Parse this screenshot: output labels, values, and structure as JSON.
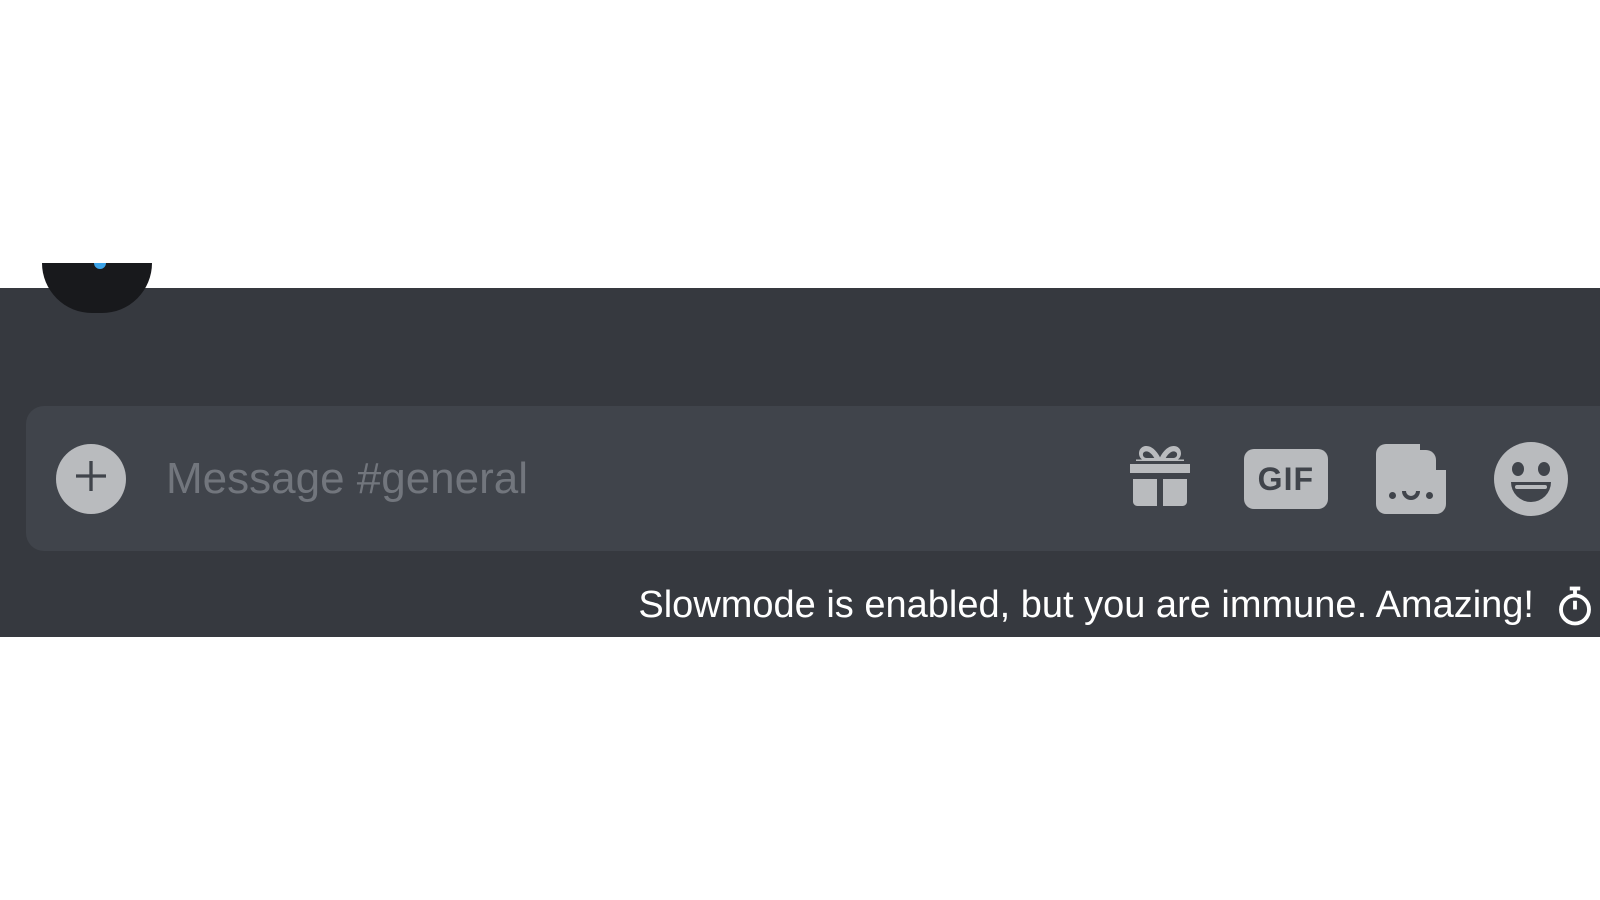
{
  "messageInput": {
    "placeholder": "Message #general"
  },
  "actions": {
    "gifLabel": "GIF"
  },
  "status": {
    "slowmodeText": "Slowmode is enabled, but you are immune. Amazing!"
  }
}
